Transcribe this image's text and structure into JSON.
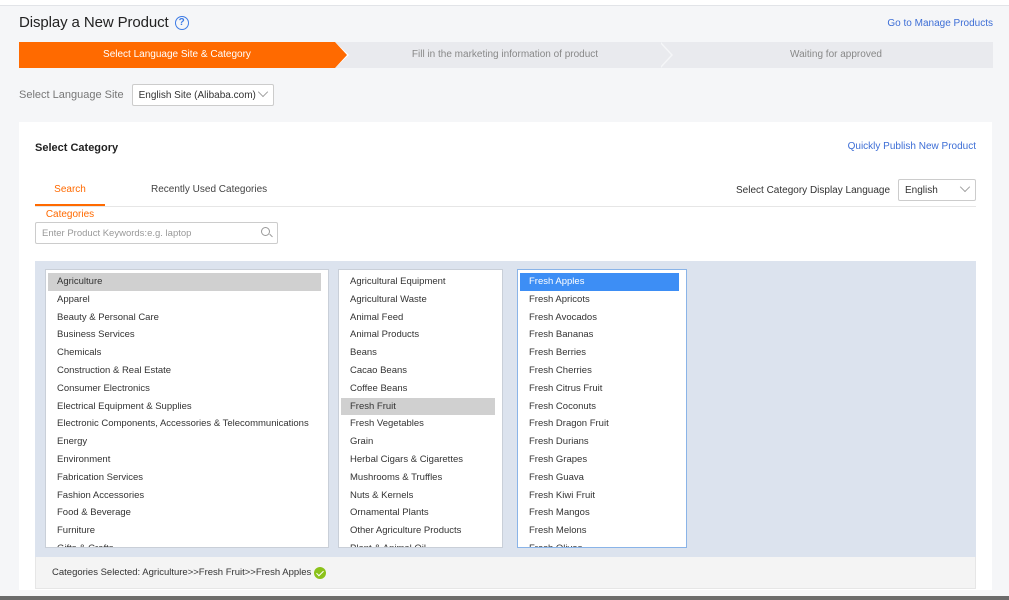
{
  "header": {
    "title": "Display a New Product",
    "help_icon": "question-circle-icon",
    "manage_link": "Go to Manage Products"
  },
  "steps": [
    {
      "label": "Select Language Site & Category",
      "state": "active"
    },
    {
      "label": "Fill in the marketing information of product",
      "state": "pending"
    },
    {
      "label": "Waiting for approved",
      "state": "pending"
    }
  ],
  "language_site": {
    "label": "Select Language Site",
    "value": "English Site (Alibaba.com)"
  },
  "category": {
    "title": "Select Category",
    "quick_publish_link": "Quickly Publish New Product",
    "tabs": [
      {
        "label": "Search Categories",
        "active": true
      },
      {
        "label": "Recently Used Categories",
        "active": false
      }
    ],
    "display_language": {
      "label": "Select Category Display Language",
      "value": "English"
    },
    "search": {
      "placeholder": "Enter Product Keywords:e.g. laptop",
      "value": ""
    },
    "level1": {
      "selected": "Agriculture",
      "items": [
        "Agriculture",
        "Apparel",
        "Beauty & Personal Care",
        "Business Services",
        "Chemicals",
        "Construction & Real Estate",
        "Consumer Electronics",
        "Electrical Equipment & Supplies",
        "Electronic Components, Accessories & Telecommunications",
        "Energy",
        "Environment",
        "Fabrication Services",
        "Fashion Accessories",
        "Food & Beverage",
        "Furniture",
        "Gifts & Crafts"
      ]
    },
    "level2": {
      "selected": "Fresh Fruit",
      "items": [
        "Agricultural Equipment",
        "Agricultural Waste",
        "Animal Feed",
        "Animal Products",
        "Beans",
        "Cacao Beans",
        "Coffee Beans",
        "Fresh Fruit",
        "Fresh Vegetables",
        "Grain",
        "Herbal Cigars & Cigarettes",
        "Mushrooms & Truffles",
        "Nuts & Kernels",
        "Ornamental Plants",
        "Other Agriculture Products",
        "Plant & Animal Oil"
      ]
    },
    "level3": {
      "selected": "Fresh Apples",
      "items": [
        "Fresh Apples",
        "Fresh Apricots",
        "Fresh Avocados",
        "Fresh Bananas",
        "Fresh Berries",
        "Fresh Cherries",
        "Fresh Citrus Fruit",
        "Fresh Coconuts",
        "Fresh Dragon Fruit",
        "Fresh Durians",
        "Fresh Grapes",
        "Fresh Guava",
        "Fresh Kiwi Fruit",
        "Fresh Mangos",
        "Fresh Melons",
        "Fresh Olives"
      ]
    },
    "selected_summary": "Categories Selected: Agriculture>>Fresh Fruit>>Fresh Apples"
  },
  "colors": {
    "accent": "#ff6a00",
    "link": "#3d6ed6",
    "selected_blue": "#3d8ef5",
    "check_green": "#8bc21a"
  }
}
